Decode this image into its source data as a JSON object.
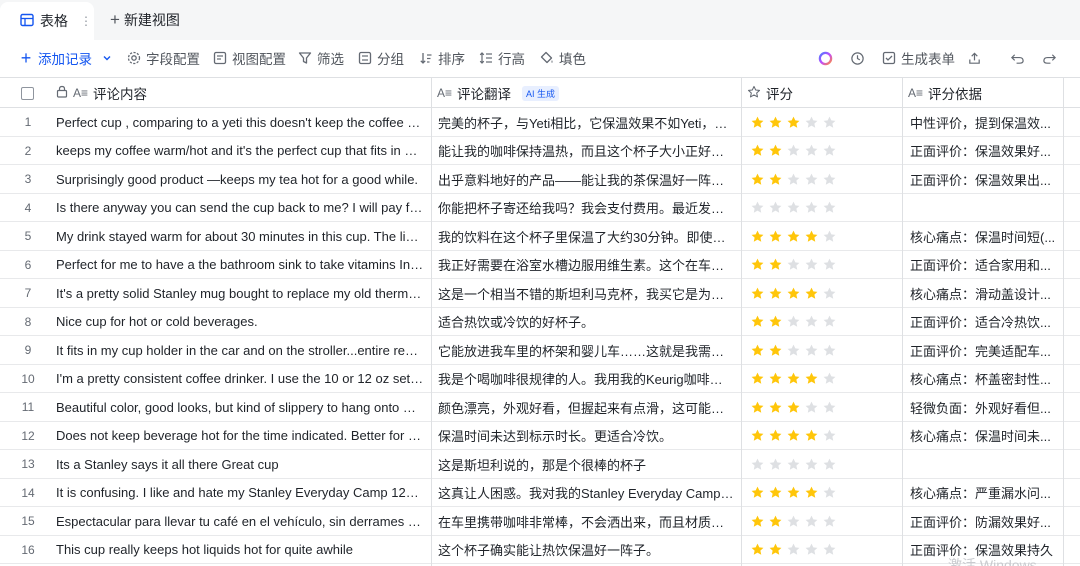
{
  "tabs": {
    "active_label": "表格",
    "new_view_label": "新建视图"
  },
  "toolbar": {
    "add_record": "添加记录",
    "field_config": "字段配置",
    "view_config": "视图配置",
    "filter": "筛选",
    "group": "分组",
    "sort": "排序",
    "row_height": "行高",
    "fill_color": "填色",
    "generate_form": "生成表单"
  },
  "columns": {
    "comment": "评论内容",
    "translation": "评论翻译",
    "ai_badge": "AI 生成",
    "rating": "评分",
    "basis": "评分依据"
  },
  "colors": {
    "accent": "#1456f0",
    "star_filled": "#ffc60a",
    "star_empty": "#dee0e3"
  },
  "rows": [
    {
      "num": "1",
      "comment": "Perfect cup , comparing to a yeti this doesn't keep the coffee wa...",
      "translation": "完美的杯子，与Yeti相比，它保温效果不如Yeti，但...",
      "rating": 3,
      "basis": "中性评价，提到保温效..."
    },
    {
      "num": "2",
      "comment": "keeps my coffee warm/hot and it's the perfect cup that fits in m...",
      "translation": "能让我的咖啡保持温热，而且这个杯子大小正好，...",
      "rating": 2,
      "basis": "正面评价：保温效果好..."
    },
    {
      "num": "3",
      "comment": "Surprisingly good product —keeps my tea hot for a good while.",
      "translation": "出乎意料地好的产品——能让我的茶保温好一阵子。",
      "rating": 2,
      "basis": "正面评价：保温效果出..."
    },
    {
      "num": "4",
      "comment": "Is there anyway you can send the cup back to me? I will pay for...",
      "translation": "你能把杯子寄还给我吗？我会支付费用。最近发生...",
      "rating": 0,
      "basis": ""
    },
    {
      "num": "5",
      "comment": "My drink stayed warm for about 30 minutes in this cup. The liqui...",
      "translation": "我的饮料在这个杯子里保温了大约30分钟。即使关...",
      "rating": 4,
      "basis": "核心痛点：保温时间短(..."
    },
    {
      "num": "6",
      "comment": "Perfect for me to have a the bathroom sink to take vitamins In . ...",
      "translation": "我正好需要在浴室水槽边服用维生素。这个在车里...",
      "rating": 2,
      "basis": "正面评价：适合家用和..."
    },
    {
      "num": "7",
      "comment": "It's a pretty solid Stanley mug bought to replace my old thermo ...",
      "translation": "这是一个相当不错的斯坦利马克杯，我买它是为了...",
      "rating": 4,
      "basis": "核心痛点：滑动盖设计..."
    },
    {
      "num": "8",
      "comment": "Nice cup for hot or cold beverages.",
      "translation": "适合热饮或冷饮的好杯子。",
      "rating": 2,
      "basis": "正面评价：适合冷热饮..."
    },
    {
      "num": "9",
      "comment": "It fits in my cup holder in the car and on the stroller...entire reas...",
      "translation": "它能放进我车里的杯架和婴儿车……这就是我需要一...",
      "rating": 2,
      "basis": "正面评价：完美适配车..."
    },
    {
      "num": "10",
      "comment": "I'm a pretty consistent coffee drinker. I use the 10 or 12 oz setti...",
      "translation": "我是个喝咖啡很规律的人。我用我的Keurig咖啡机的...",
      "rating": 4,
      "basis": "核心痛点：杯盖密封性..."
    },
    {
      "num": "11",
      "comment": "Beautiful color, good looks, but kind of slippery to hang onto whi...",
      "translation": "颜色漂亮，外观好看，但握起来有点滑，这可能会...",
      "rating": 3,
      "basis": "轻微负面：外观好看但..."
    },
    {
      "num": "12",
      "comment": "Does not keep beverage hot for the time indicated. Better for col...",
      "translation": "保温时间未达到标示时长。更适合冷饮。",
      "rating": 4,
      "basis": "核心痛点：保温时间未..."
    },
    {
      "num": "13",
      "comment": "Its a Stanley says it all there Great cup",
      "translation": "这是斯坦利说的，那是个很棒的杯子",
      "rating": 0,
      "basis": ""
    },
    {
      "num": "14",
      "comment": "It is confusing. I like and hate my Stanley Everyday Camp 12oz ...",
      "translation": "这真让人困惑。我对我的Stanley Everyday Camp 12...",
      "rating": 4,
      "basis": "核心痛点：严重漏水问..."
    },
    {
      "num": "15",
      "comment": "Espectacular para llevar tu café en el vehículo, sin derrames y es...",
      "translation": "在车里携带咖啡非常棒，不会洒出来，而且材质很...",
      "rating": 2,
      "basis": "正面评价：防漏效果好..."
    },
    {
      "num": "16",
      "comment": "This cup really keeps hot liquids hot for quite awhile",
      "translation": "这个杯子确实能让热饮保温好一阵子。",
      "rating": 2,
      "basis": "正面评价：保温效果持久"
    }
  ],
  "watermark": "激活 Windows"
}
